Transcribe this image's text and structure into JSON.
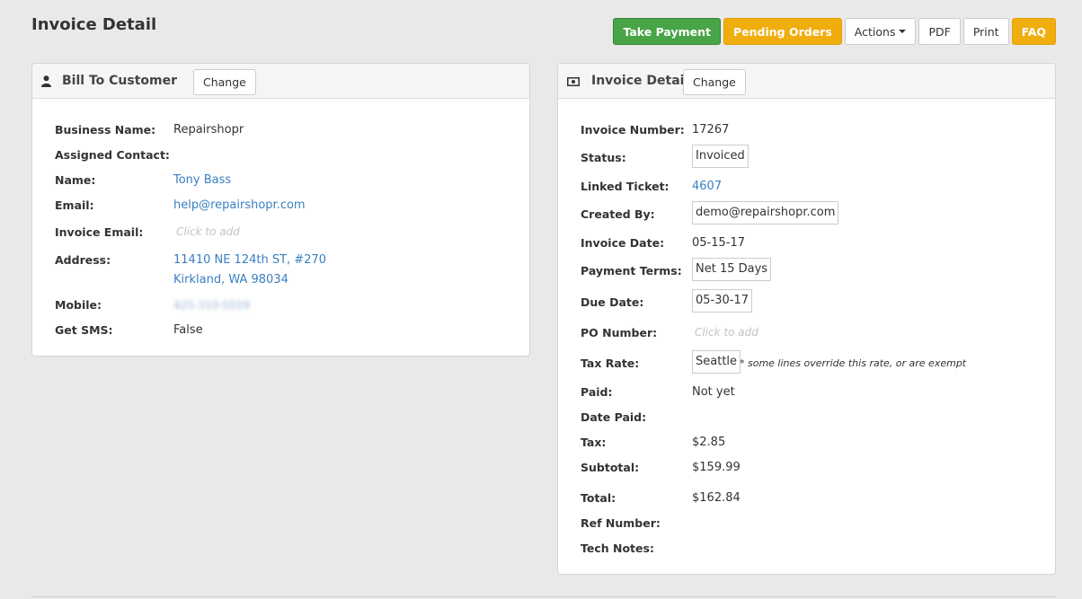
{
  "page": {
    "title": "Invoice Detail"
  },
  "toolbar": {
    "take_payment": "Take Payment",
    "pending_orders": "Pending Orders",
    "actions": "Actions",
    "pdf": "PDF",
    "print": "Print",
    "faq": "FAQ"
  },
  "colors": {
    "take_payment": "#47a447",
    "pending_orders": "#f0ad0e",
    "faq": "#f0ad0e",
    "link": "#3a7fc1"
  },
  "customer_panel": {
    "icon": "user-icon",
    "title": "Bill To Customer",
    "change_label": "Change",
    "fields": {
      "business_name": {
        "label": "Business Name:",
        "value": "Repairshopr"
      },
      "assigned_contact": {
        "label": "Assigned Contact:",
        "value": ""
      },
      "name": {
        "label": "Name:",
        "value": "Tony Bass"
      },
      "email": {
        "label": "Email:",
        "value": "help@repairshopr.com"
      },
      "invoice_email": {
        "label": "Invoice Email:",
        "placeholder": "Click to add"
      },
      "address": {
        "label": "Address:",
        "line1": "11410 NE 124th ST, #270",
        "line2": "Kirkland, WA 98034"
      },
      "mobile": {
        "label": "Mobile:",
        "value": "425-310-5559"
      },
      "get_sms": {
        "label": "Get SMS:",
        "value": "False"
      }
    }
  },
  "invoice_panel": {
    "icon": "money-icon",
    "title": "Invoice Details",
    "change_label": "Change",
    "fields": {
      "invoice_number": {
        "label": "Invoice Number:",
        "value": "17267"
      },
      "status": {
        "label": "Status:",
        "value": "Invoiced"
      },
      "linked_ticket": {
        "label": "Linked Ticket:",
        "value": "4607"
      },
      "created_by": {
        "label": "Created By:",
        "value": "demo@repairshopr.com"
      },
      "invoice_date": {
        "label": "Invoice Date:",
        "value": "05-15-17"
      },
      "payment_terms": {
        "label": "Payment Terms:",
        "value": "Net 15 Days"
      },
      "due_date": {
        "label": "Due Date:",
        "value": "05-30-17"
      },
      "po_number": {
        "label": "PO Number:",
        "placeholder": "Click to add"
      },
      "tax_rate": {
        "label": "Tax Rate:",
        "value": "Seattle",
        "note": "* some lines override this rate, or are exempt"
      },
      "paid": {
        "label": "Paid:",
        "value": "Not yet"
      },
      "date_paid": {
        "label": "Date Paid:",
        "value": ""
      },
      "tax": {
        "label": "Tax:",
        "value": "$2.85"
      },
      "subtotal": {
        "label": "Subtotal:",
        "value": "$159.99"
      },
      "total": {
        "label": "Total:",
        "value": "$162.84"
      },
      "ref_number": {
        "label": "Ref Number:",
        "value": ""
      },
      "tech_notes": {
        "label": "Tech Notes:",
        "value": ""
      }
    }
  }
}
